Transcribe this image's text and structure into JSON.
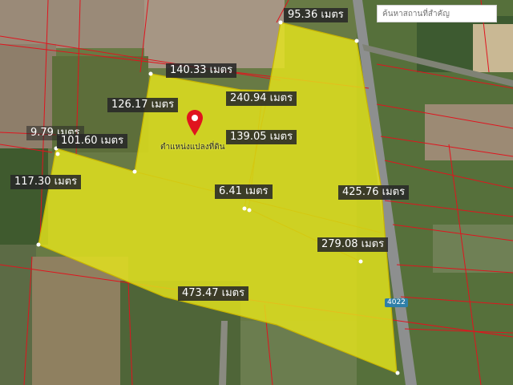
{
  "search": {
    "placeholder": "ค้นหาสถานที่สำคัญ"
  },
  "place_name": "ตำแหน่งแปลงที่ดิน",
  "road_number": "4022",
  "measurements": [
    "95.36 เมตร",
    "140.33 เมตร",
    "126.17 เมตร",
    "240.94 เมตร",
    "139.05 เมตร",
    "9.79 เมตร",
    "101.60 เมตร",
    "117.30 เมตร",
    "6.41 เมตร",
    "425.76 เมตร",
    "279.08 เมตร",
    "473.47 เมตร"
  ],
  "colors": {
    "parcel_fill": "#e4e41c",
    "parcel_outline": "#c8b400",
    "boundary_lines": "#e0141e",
    "label_bg": "#282828"
  }
}
